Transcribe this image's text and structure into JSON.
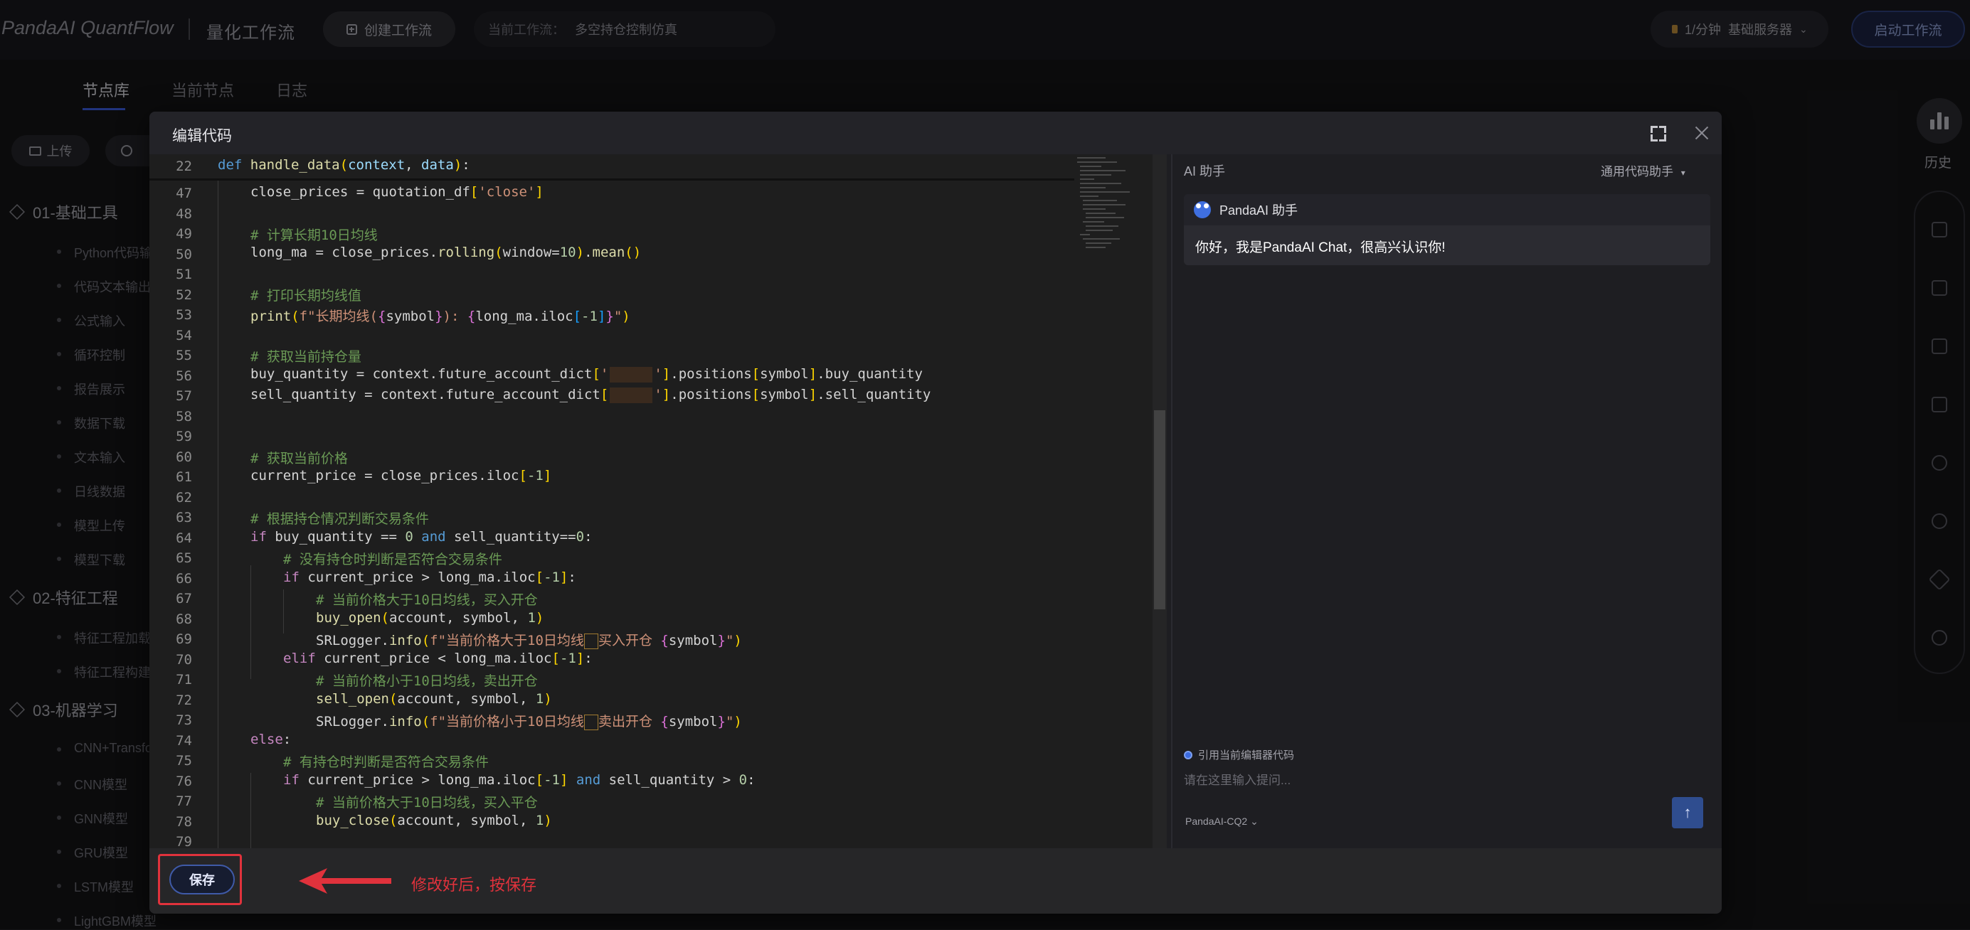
{
  "app": {
    "logo": "PandaAI QuantFlow",
    "subtitle": "量化工作流"
  },
  "topbar": {
    "create_label": "创建工作流",
    "current_workflow_label": "当前工作流：",
    "current_workflow_value": "多空持仓控制仿真",
    "server_price": "1/分钟",
    "server_name": "基础服务器",
    "start_label": "启动工作流"
  },
  "tabs": [
    {
      "label": "节点库",
      "active": true
    },
    {
      "label": "当前节点",
      "active": false
    },
    {
      "label": "日志",
      "active": false
    }
  ],
  "left_panel": {
    "upload_label": "上传",
    "categories": [
      {
        "name": "01-基础工具",
        "items": [
          "Python代码输",
          "代码文本输出",
          "公式输入",
          "循环控制",
          "报告展示",
          "数据下载",
          "文本输入",
          "日线数据",
          "模型上传",
          "模型下载"
        ]
      },
      {
        "name": "02-特征工程",
        "items": [
          "特征工程加载",
          "特征工程构建"
        ]
      },
      {
        "name": "03-机器学习",
        "items": [
          "CNN+Transfo",
          "CNN模型",
          "GNN模型",
          "GRU模型",
          "LSTM模型",
          "LightGBM模型"
        ]
      }
    ]
  },
  "right_toolbar": {
    "history_label": "历史"
  },
  "modal": {
    "title": "编辑代码",
    "save_label": "保存",
    "annotation": "修改好后，按保存"
  },
  "editor": {
    "sticky_line": {
      "num": "22",
      "code": "def handle_data(context, data):"
    },
    "line_numbers": [
      "47",
      "48",
      "49",
      "50",
      "51",
      "52",
      "53",
      "54",
      "55",
      "56",
      "57",
      "58",
      "59",
      "60",
      "61",
      "62",
      "63",
      "64",
      "65",
      "66",
      "67",
      "68",
      "69",
      "70",
      "71",
      "72",
      "73",
      "74",
      "75",
      "76",
      "77",
      "78",
      "79"
    ]
  },
  "ai": {
    "title": "AI 助手",
    "mode": "通用代码助手",
    "bot_name": "PandaAI 助手",
    "greeting": "你好，我是PandaAI Chat，很高兴认识你!",
    "cite_label": "引用当前编辑器代码",
    "input_placeholder": "请在这里输入提问...",
    "model": "PandaAI-CQ2"
  },
  "colors": {
    "accent": "#3a5ad9",
    "annotation_red": "#e0323c"
  }
}
